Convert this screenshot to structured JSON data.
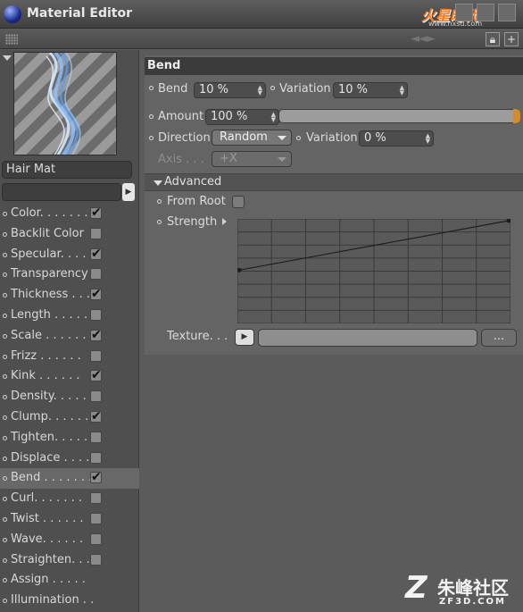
{
  "window": {
    "title": "Material Editor",
    "controls": [
      "help-icon",
      "maximize-icon",
      "close-icon"
    ]
  },
  "watermark_top": {
    "logo": "火星时代",
    "url": "www.hxsd.com"
  },
  "toolbar": {
    "icons": [
      "grip-icon",
      "lock-icon",
      "new-window-icon"
    ]
  },
  "material": {
    "name": "Hair Mat"
  },
  "channels": [
    {
      "label": "Color. . . . . . .",
      "checked": true
    },
    {
      "label": "Backlit Color",
      "checked": false
    },
    {
      "label": "Specular. . . .",
      "checked": true
    },
    {
      "label": "Transparency",
      "checked": false
    },
    {
      "label": "Thickness . . .",
      "checked": true
    },
    {
      "label": "Length . . . . .",
      "checked": false
    },
    {
      "label": "Scale . . . . . .",
      "checked": true
    },
    {
      "label": "Frizz . . . . . .",
      "checked": false
    },
    {
      "label": "Kink . . . . . .",
      "checked": true
    },
    {
      "label": "Density. . . . . .",
      "checked": false
    },
    {
      "label": "Clump. . . . . .",
      "checked": true
    },
    {
      "label": "Tighten. . . . .",
      "checked": false
    },
    {
      "label": "Displace . . . .",
      "checked": false
    },
    {
      "label": "Bend . . . . . . .",
      "checked": true,
      "active": true
    },
    {
      "label": "Curl. . . . . . .",
      "checked": false
    },
    {
      "label": "Twist . . . . . .",
      "checked": false
    },
    {
      "label": "Wave. . . . . .",
      "checked": false
    },
    {
      "label": "Straighten. . .",
      "checked": false
    },
    {
      "label": "Assign . . . . .",
      "checked": null
    },
    {
      "label": "Illumination . .",
      "checked": null
    }
  ],
  "bend": {
    "section_title": "Bend",
    "bend_label": "Bend",
    "bend_value": "10 %",
    "variation_label": "Variation",
    "variation_value": "10 %",
    "amount_label": "Amount",
    "amount_value": "100 %",
    "direction_label": "Direction",
    "direction_value": "Random",
    "dir_variation_label": "Variation",
    "dir_variation_value": "0 %",
    "axis_label": "Axis . . .",
    "axis_value": "+X"
  },
  "advanced": {
    "title": "Advanced",
    "from_root_label": "From Root",
    "strength_label": "Strength",
    "strength_curve": {
      "start": 0,
      "end": 1
    },
    "texture_label": "Texture. . .",
    "texture_more": "..."
  },
  "watermark_bottom": {
    "logo": "Z",
    "name": "朱峰社区",
    "url": "ZF3D.COM"
  }
}
